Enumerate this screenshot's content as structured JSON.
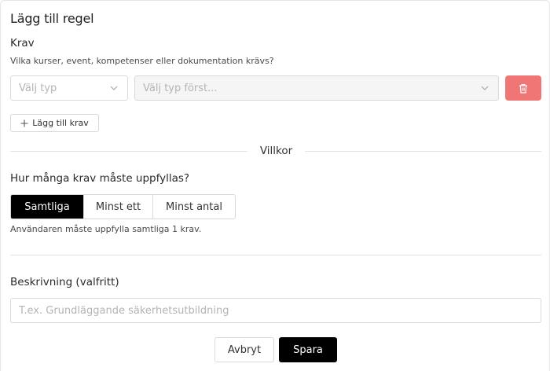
{
  "dialog": {
    "title": "Lägg till regel"
  },
  "requirements": {
    "label": "Krav",
    "helper": "Vilka kurser, event, kompetenser eller dokumentation krävs?",
    "type_select": {
      "placeholder": "Välj typ"
    },
    "value_select": {
      "placeholder": "Välj typ först..."
    },
    "delete_icon": "trash-icon",
    "add_button_label": "Lägg till krav",
    "add_icon": "plus-icon"
  },
  "conditions": {
    "divider_label": "Villkor",
    "question": "Hur många krav måste uppfyllas?",
    "options": [
      {
        "label": "Samtliga",
        "selected": true
      },
      {
        "label": "Minst ett",
        "selected": false
      },
      {
        "label": "Minst antal",
        "selected": false
      }
    ],
    "helper": "Användaren måste uppfylla samtliga 1 krav."
  },
  "description": {
    "label": "Beskrivning (valfritt)",
    "placeholder": "T.ex. Grundläggande säkerhetsutbildning",
    "value": ""
  },
  "footer": {
    "cancel_label": "Avbryt",
    "save_label": "Spara"
  },
  "colors": {
    "delete_button": "#f07575",
    "primary": "#000000",
    "border": "#d9d9d9"
  }
}
